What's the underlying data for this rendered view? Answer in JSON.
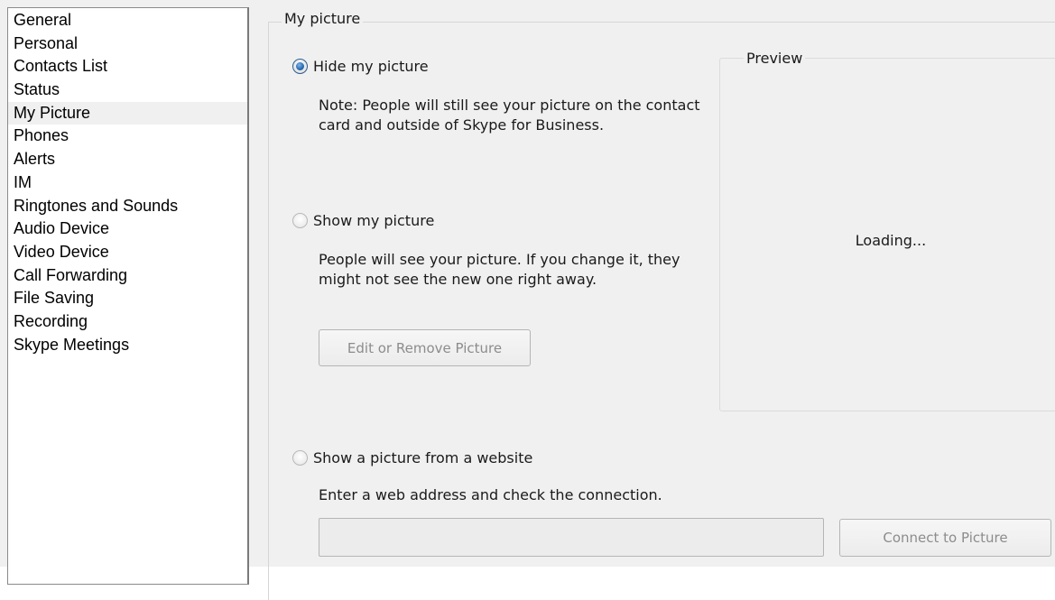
{
  "sidebar": {
    "items": [
      {
        "label": "General"
      },
      {
        "label": "Personal"
      },
      {
        "label": "Contacts List"
      },
      {
        "label": "Status"
      },
      {
        "label": "My Picture"
      },
      {
        "label": "Phones"
      },
      {
        "label": "Alerts"
      },
      {
        "label": "IM"
      },
      {
        "label": "Ringtones and Sounds"
      },
      {
        "label": "Audio Device"
      },
      {
        "label": "Video Device"
      },
      {
        "label": "Call Forwarding"
      },
      {
        "label": "File Saving"
      },
      {
        "label": "Recording"
      },
      {
        "label": "Skype Meetings"
      }
    ],
    "selected": "My Picture"
  },
  "section": {
    "title": "My picture"
  },
  "options": {
    "hide": {
      "label": "Hide my picture",
      "checked": true,
      "note_line1": "Note: People will still see your picture on the contact",
      "note_line2": "card and outside of Skype for Business."
    },
    "show": {
      "label": "Show my picture",
      "checked": false,
      "note_line1": "People will see your picture. If you change it, they",
      "note_line2": "might not see the new one right away.",
      "edit_button": "Edit or Remove Picture"
    },
    "website": {
      "label": "Show a picture from a website",
      "checked": false,
      "note": "Enter a web address and check the connection.",
      "url_value": "",
      "connect_button": "Connect to Picture"
    }
  },
  "preview": {
    "title": "Preview",
    "status": "Loading..."
  }
}
